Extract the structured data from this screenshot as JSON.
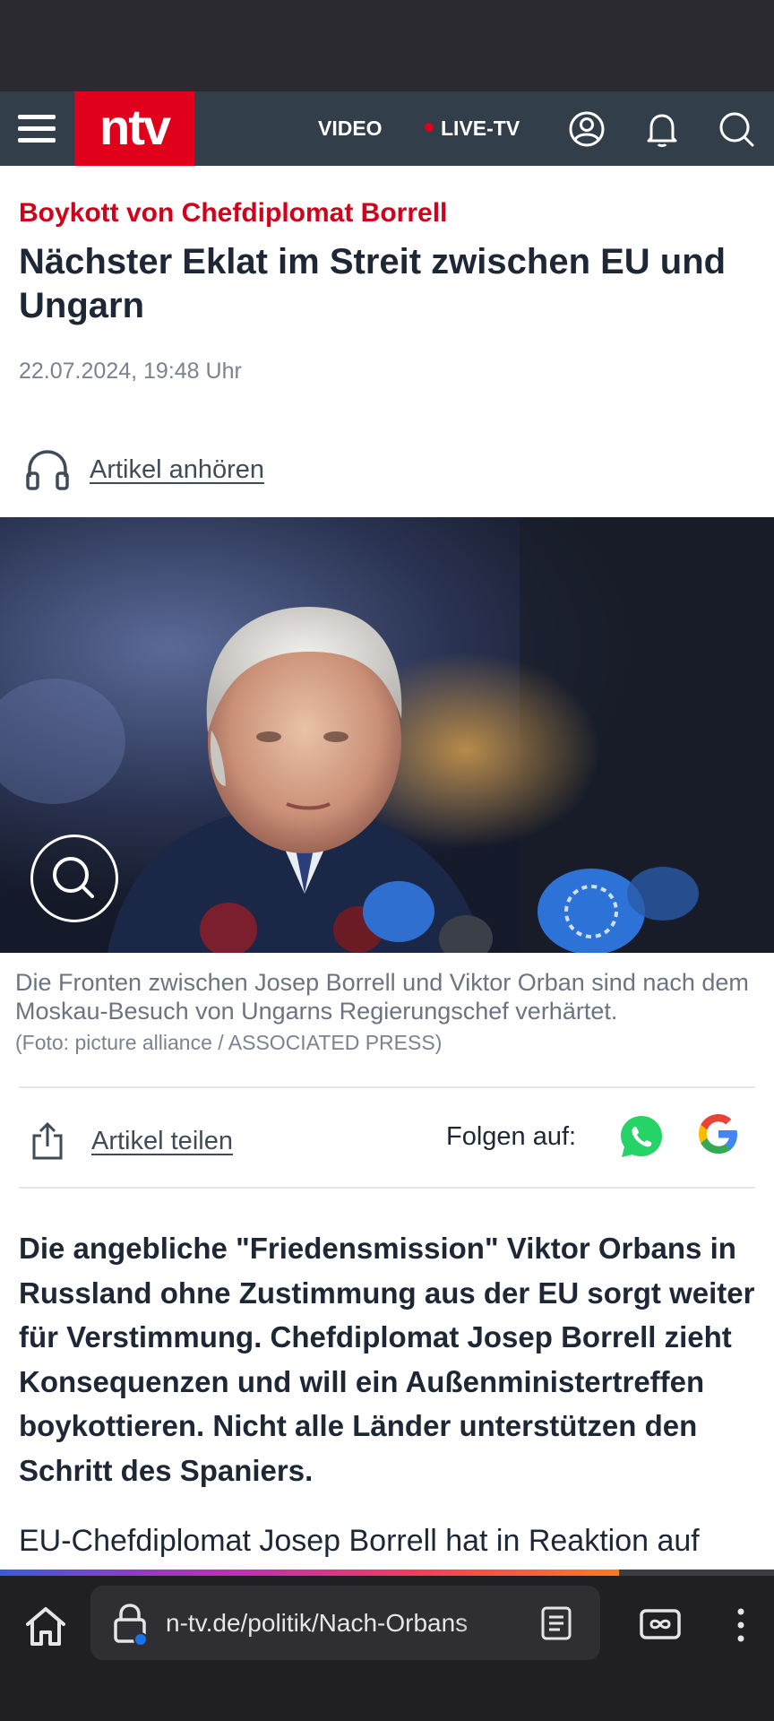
{
  "header": {
    "logo_text": "ntv",
    "nav_video": "VIDEO",
    "nav_live": "LIVE-TV",
    "icons": [
      "menu-icon",
      "profile-icon",
      "bell-icon",
      "search-icon"
    ],
    "colors": {
      "bar": "#323e4a",
      "brand": "#e0001b"
    }
  },
  "article": {
    "kicker": "Boykott von Chefdiplomat Borrell",
    "headline": "Nächster Eklat im Streit zwischen EU und Ungarn",
    "date": "22.07.2024, 19:48 Uhr",
    "listen_label": "Artikel anhören",
    "image_caption": "Die Fronten zwischen Josep Borrell und Viktor Orban sind nach dem Moskau-Besuch von Ungarns Regierungschef verhärtet.",
    "image_credit": "(Foto: picture alliance / ASSOCIATED PRESS)",
    "share_label": "Artikel teilen",
    "follow_label": "Folgen auf:",
    "lead": "Die angebliche \"Friedensmission\" Viktor Orbans in Russland ohne Zustimmung aus der EU sorgt weiter für Verstimmung. Chefdiplomat Josep Borrell zieht Konsequenzen und will ein Außenministertreffen boykottieren. Nicht alle Länder unterstützen den Schritt des Spaniers.",
    "body_start": "EU-Chefdiplomat Josep Borrell hat in Reaktion auf"
  },
  "browser": {
    "url": "n-tv.de/politik/Nach-Orbans",
    "page_load_progress": 0.8,
    "icons": [
      "home-icon",
      "lock-icon",
      "reader-mode-icon",
      "tabs-icon",
      "more-icon"
    ]
  }
}
